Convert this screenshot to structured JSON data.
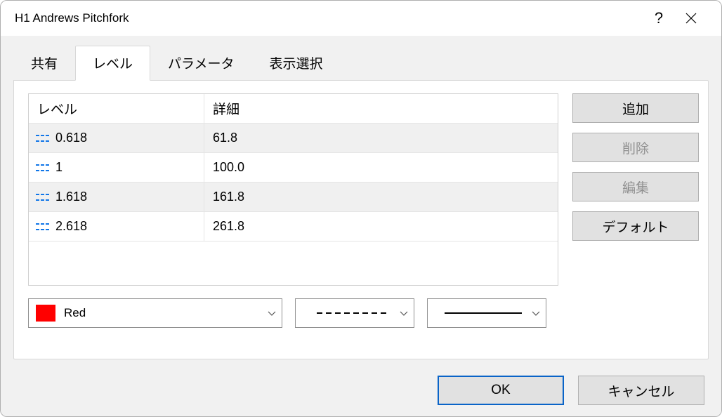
{
  "window": {
    "title": "H1 Andrews Pitchfork"
  },
  "tabs": {
    "share": "共有",
    "levels": "レベル",
    "params": "パラメータ",
    "display": "表示選択"
  },
  "table": {
    "header_level": "レベル",
    "header_detail": "詳細",
    "rows": [
      {
        "level": "0.618",
        "detail": "61.8"
      },
      {
        "level": "1",
        "detail": "100.0"
      },
      {
        "level": "1.618",
        "detail": "161.8"
      },
      {
        "level": "2.618",
        "detail": "261.8"
      }
    ]
  },
  "buttons": {
    "add": "追加",
    "delete": "削除",
    "edit": "編集",
    "default": "デフォルト",
    "ok": "OK",
    "cancel": "キャンセル"
  },
  "props": {
    "color_name": "Red",
    "color_hex": "#ff0000"
  }
}
